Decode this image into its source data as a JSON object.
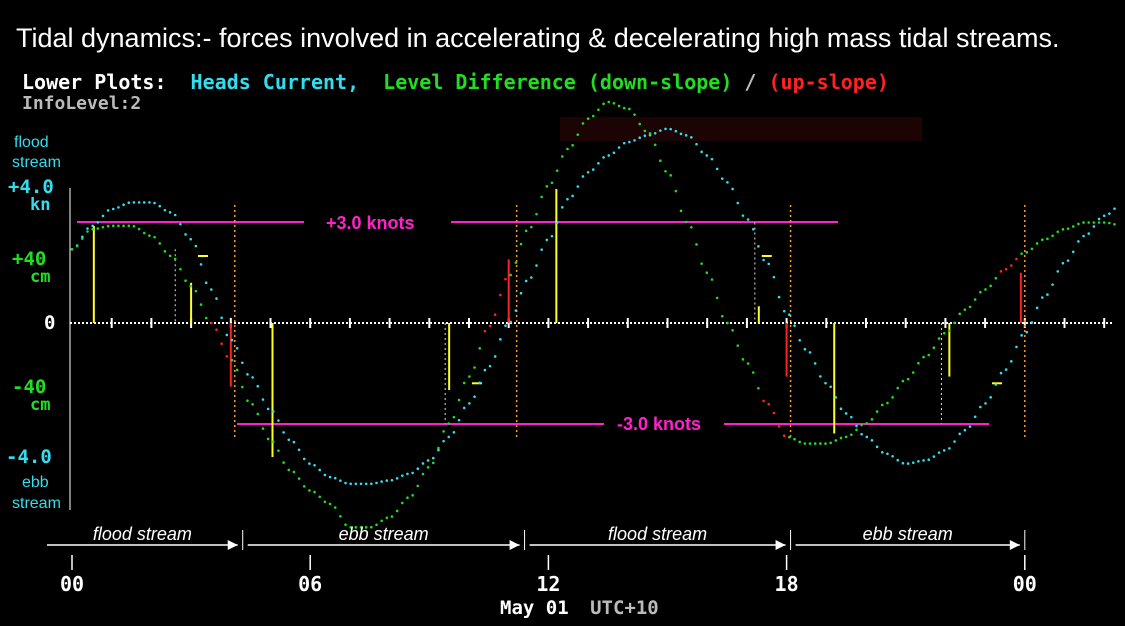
{
  "header": {
    "title": "Tidal dynamics:-  forces involved in accelerating & decelerating high mass tidal streams.",
    "legend_prefix": "Lower Plots:",
    "legend_current": "Heads Current,",
    "legend_level": "Level Difference (down-slope)",
    "legend_slash": "/",
    "legend_upslope": "(up-slope)",
    "info_level": "InfoLevel:2"
  },
  "colors": {
    "background": "#000000",
    "current": "#33ddee",
    "level": "#22dd22",
    "upslope": "#ff2222",
    "knots": "#ff22cc",
    "yellow_bar": "#ffff22",
    "orange_marker": "#ff9922",
    "axis": "#ffffff"
  },
  "chart_data": {
    "type": "line",
    "x_label": "May 01 UTC+10",
    "x_ticks": [
      "00",
      "06",
      "12",
      "18",
      "00"
    ],
    "x_range_hours": [
      0,
      25
    ],
    "y_range": [
      -4.4,
      4.3
    ],
    "y_axis_labels": {
      "top": "flood\nstream",
      "current_pos": "+4.0",
      "current_pos_unit": "kn",
      "level_pos": "+40",
      "level_pos_unit": "cm",
      "zero": "0",
      "level_neg": "-40",
      "level_neg_unit": "cm",
      "current_neg": "-4.0",
      "bottom": "ebb\nstream"
    },
    "series": [
      {
        "name": "Heads Current",
        "units": "knots",
        "points": [
          [
            0,
            2.2
          ],
          [
            0.5,
            2.9
          ],
          [
            1,
            3.4
          ],
          [
            1.5,
            3.6
          ],
          [
            2,
            3.6
          ],
          [
            2.5,
            3.3
          ],
          [
            3,
            2.5
          ],
          [
            3.5,
            1.0
          ],
          [
            4,
            -0.5
          ],
          [
            4.5,
            -1.6
          ],
          [
            5,
            -2.6
          ],
          [
            5.5,
            -3.5
          ],
          [
            6,
            -4.2
          ],
          [
            6.5,
            -4.6
          ],
          [
            7,
            -4.8
          ],
          [
            7.5,
            -4.8
          ],
          [
            8,
            -4.7
          ],
          [
            8.5,
            -4.5
          ],
          [
            9,
            -4.1
          ],
          [
            9.5,
            -3.4
          ],
          [
            10,
            -2.4
          ],
          [
            10.5,
            -1.3
          ],
          [
            11,
            0
          ],
          [
            11.5,
            1.3
          ],
          [
            12,
            2.5
          ],
          [
            12.5,
            3.7
          ],
          [
            13,
            4.5
          ],
          [
            13.5,
            5.0
          ],
          [
            14,
            5.4
          ],
          [
            14.5,
            5.6
          ],
          [
            15,
            5.8
          ],
          [
            15.5,
            5.6
          ],
          [
            16,
            5.0
          ],
          [
            16.5,
            4.2
          ],
          [
            17,
            3.1
          ],
          [
            17.5,
            1.8
          ],
          [
            18,
            0.3
          ],
          [
            18.5,
            -0.8
          ],
          [
            19,
            -1.8
          ],
          [
            19.5,
            -2.7
          ],
          [
            20,
            -3.4
          ],
          [
            20.5,
            -3.9
          ],
          [
            21,
            -4.2
          ],
          [
            21.5,
            -4.1
          ],
          [
            22,
            -3.8
          ],
          [
            22.5,
            -3.2
          ],
          [
            23,
            -2.4
          ],
          [
            23.5,
            -1.4
          ],
          [
            24,
            -0.3
          ],
          [
            24.5,
            0.8
          ],
          [
            25,
            1.8
          ],
          [
            25.5,
            2.6
          ],
          [
            26,
            3.2
          ],
          [
            26.5,
            3.6
          ],
          [
            27,
            3.8
          ]
        ]
      },
      {
        "name": "Level Difference",
        "units": "cm",
        "points": [
          [
            0,
            2.2
          ],
          [
            0.5,
            2.8
          ],
          [
            1,
            2.9
          ],
          [
            1.5,
            2.9
          ],
          [
            2,
            2.6
          ],
          [
            2.5,
            2.0
          ],
          [
            3,
            1.1
          ],
          [
            3.5,
            0
          ],
          [
            4,
            -1.1
          ],
          [
            4.5,
            -2.4
          ],
          [
            5,
            -3.5
          ],
          [
            5.5,
            -4.4
          ],
          [
            6,
            -5.0
          ],
          [
            6.5,
            -5.4
          ],
          [
            7,
            -6.1
          ],
          [
            7.5,
            -6.1
          ],
          [
            8,
            -5.8
          ],
          [
            8.5,
            -5.2
          ],
          [
            9,
            -4.3
          ],
          [
            9.5,
            -3.0
          ],
          [
            10,
            -1.6
          ],
          [
            10.5,
            -0.1
          ],
          [
            11,
            1.4
          ],
          [
            11.5,
            2.8
          ],
          [
            12,
            4.1
          ],
          [
            12.5,
            5.2
          ],
          [
            13,
            6.1
          ],
          [
            13.5,
            6.6
          ],
          [
            14,
            6.4
          ],
          [
            14.5,
            5.7
          ],
          [
            15,
            4.5
          ],
          [
            15.5,
            3.0
          ],
          [
            16,
            1.5
          ],
          [
            16.5,
            0
          ],
          [
            17,
            -1.2
          ],
          [
            17.5,
            -2.4
          ],
          [
            18,
            -3.4
          ],
          [
            18.5,
            -3.6
          ],
          [
            19,
            -3.6
          ],
          [
            19.5,
            -3.4
          ],
          [
            20,
            -3.0
          ],
          [
            20.5,
            -2.4
          ],
          [
            21,
            -1.7
          ],
          [
            21.5,
            -1.0
          ],
          [
            22,
            -0.3
          ],
          [
            22.5,
            0.4
          ],
          [
            23,
            1.0
          ],
          [
            23.5,
            1.6
          ],
          [
            24,
            2.1
          ],
          [
            24.5,
            2.5
          ],
          [
            25,
            2.8
          ],
          [
            25.5,
            3.0
          ],
          [
            26,
            3.0
          ],
          [
            26.5,
            2.9
          ],
          [
            27,
            2.8
          ]
        ]
      }
    ],
    "reference_lines": [
      {
        "label": "+3.0 knots",
        "value": 3.0
      },
      {
        "label": "-3.0 knots",
        "value": -3.0
      }
    ],
    "streams": [
      {
        "label": "flood stream",
        "from": 0,
        "to": 4.3
      },
      {
        "label": "ebb stream",
        "from": 4.3,
        "to": 11.4
      },
      {
        "label": "flood stream",
        "from": 11.4,
        "to": 18.1
      },
      {
        "label": "ebb stream",
        "from": 18.1,
        "to": 24
      }
    ],
    "yellow_bars": [
      [
        0.55,
        2.9
      ],
      [
        3.0,
        1.2
      ],
      [
        5.05,
        -4.0
      ],
      [
        9.5,
        -2.0
      ],
      [
        12.2,
        4.0
      ],
      [
        17.3,
        0.5
      ],
      [
        19.2,
        -3.3
      ],
      [
        22.1,
        -1.6
      ]
    ],
    "red_bars": [
      [
        4.0,
        -1.9
      ],
      [
        11.0,
        1.9
      ],
      [
        18.0,
        -1.6
      ],
      [
        23.9,
        1.5
      ]
    ],
    "gray_dashes": [
      [
        2.6,
        2.2
      ],
      [
        9.4,
        -3.0
      ],
      [
        17.2,
        3.0
      ],
      [
        21.9,
        -3.0
      ]
    ],
    "orange_markers": [
      4.1,
      11.2,
      18.1,
      24.0
    ],
    "yellow_ticks": [
      [
        3.3,
        2.0
      ],
      [
        10.2,
        -1.8
      ],
      [
        17.5,
        2.0
      ],
      [
        23.3,
        -1.8
      ]
    ],
    "grid": false
  },
  "footer": {
    "date": "May 01",
    "tz": "UTC+10"
  }
}
